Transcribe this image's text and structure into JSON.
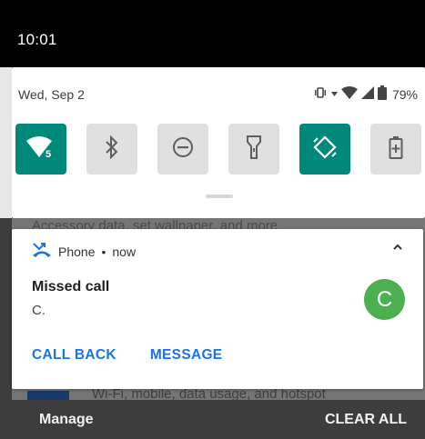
{
  "status_bar": {
    "time": "10:01"
  },
  "quick_settings": {
    "date": "Wed, Sep 2",
    "battery_percent": "79%",
    "wifi_badge": "5",
    "tiles": [
      {
        "name": "wifi",
        "state": "on"
      },
      {
        "name": "bluetooth",
        "state": "off"
      },
      {
        "name": "do-not-disturb",
        "state": "off"
      },
      {
        "name": "flashlight",
        "state": "off"
      },
      {
        "name": "auto-rotate",
        "state": "on"
      },
      {
        "name": "battery-saver",
        "state": "off"
      }
    ],
    "colors": {
      "active": "#00897b",
      "inactive": "#e0e0e0"
    }
  },
  "background": {
    "top_text": "Accessory data, set wallpaper, and more",
    "bottom_text": "Wi-Fi, mobile, data usage, and hotspot"
  },
  "notification": {
    "app": "Phone",
    "separator": "•",
    "time": "now",
    "title": "Missed call",
    "body": "C.",
    "avatar_letter": "C",
    "avatar_color": "#4caf50",
    "actions": {
      "call_back": "CALL BACK",
      "message": "MESSAGE"
    },
    "accent": "#1a73e8"
  },
  "footer": {
    "manage": "Manage",
    "clear_all": "CLEAR ALL"
  }
}
